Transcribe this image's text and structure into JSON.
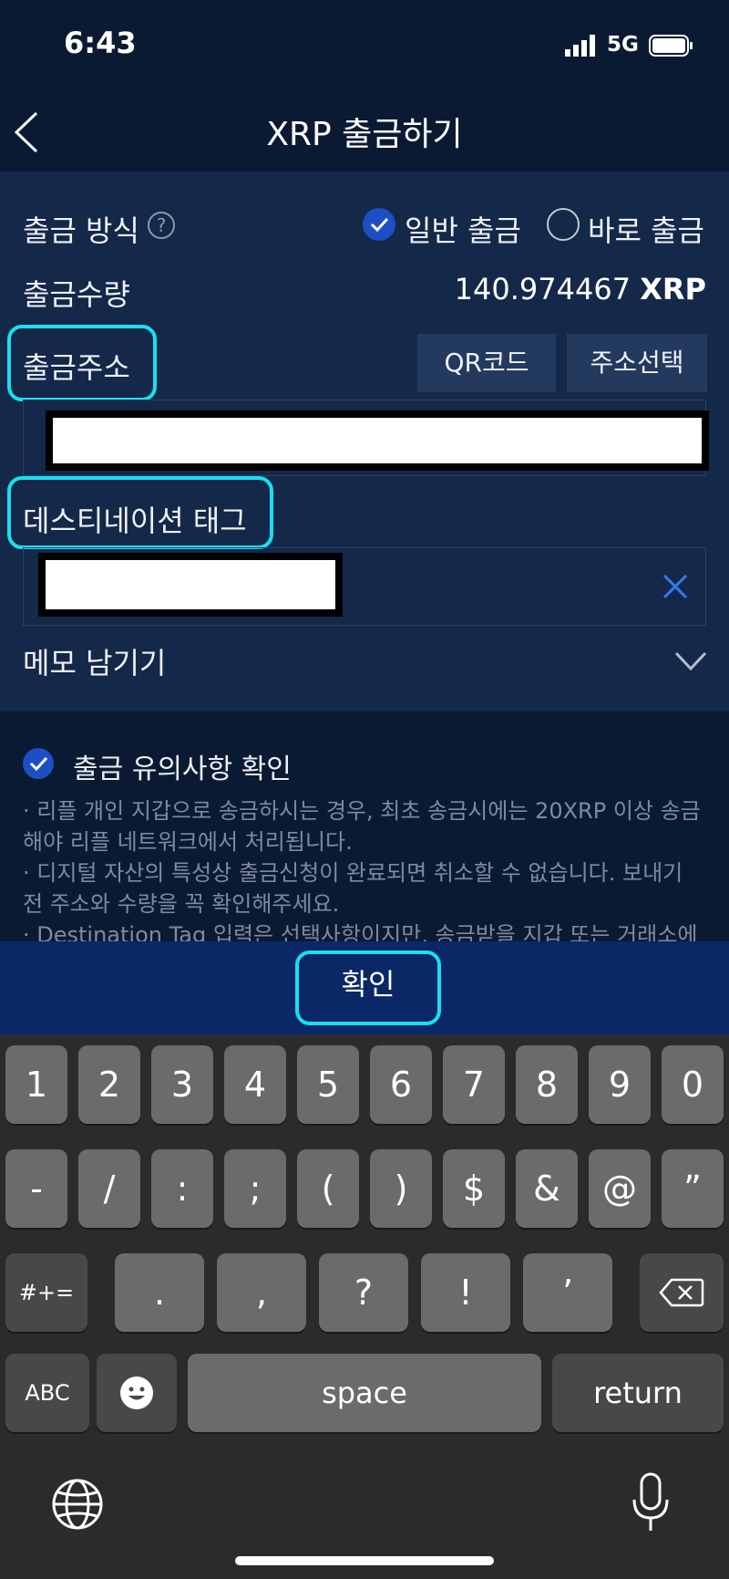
{
  "status": {
    "time": "6:43",
    "network": "5G"
  },
  "header": {
    "title": "XRP 출금하기"
  },
  "form": {
    "method_label": "출금 방식",
    "help_icon": "?",
    "option_normal": "일반 출금",
    "option_instant": "바로 출금",
    "selected_option": "일반 출금",
    "amount_label": "출금수량",
    "amount_value": "140.974467",
    "amount_unit": "XRP",
    "address_label": "출금주소",
    "qr_button": "QR코드",
    "select_address_button": "주소선택",
    "tag_label": "데스티네이션 태그",
    "memo_label": "메모 남기기"
  },
  "notice": {
    "title": "출금 유의사항 확인",
    "items": [
      "리플 개인 지갑으로 송금하시는 경우, 최초 송금시에는 20XRP 이상 송금해야 리플 네트워크에서 처리됩니다.",
      "디지털 자산의 특성상 출금신청이 완료되면 취소할 수 없습니다. 보내기 전 주소와 수량을 꼭 확인해주세요.",
      "Destination Tag 입력은 선택사항이지만, 송금받을 지갑 또는 거래소에"
    ]
  },
  "confirm_label": "확인",
  "keyboard": {
    "row1": [
      "1",
      "2",
      "3",
      "4",
      "5",
      "6",
      "7",
      "8",
      "9",
      "0"
    ],
    "row2": [
      "-",
      "/",
      ":",
      ";",
      "(",
      ")",
      "$",
      "&",
      "@",
      "”"
    ],
    "row3_mode": "#+=",
    "row3": [
      ".",
      ",",
      "?",
      "!",
      "’"
    ],
    "abc": "ABC",
    "space": "space",
    "return": "return"
  },
  "icons": {
    "back": "chevron-left-icon",
    "clear": "close-icon",
    "memo": "chevron-down-icon",
    "emoji": "emoji-icon",
    "backspace": "backspace-icon",
    "globe": "globe-icon",
    "mic": "microphone-icon"
  },
  "colors": {
    "accent": "#1d4fc4",
    "highlight": "#19e0ee",
    "confirm_bar": "#0a2865"
  }
}
